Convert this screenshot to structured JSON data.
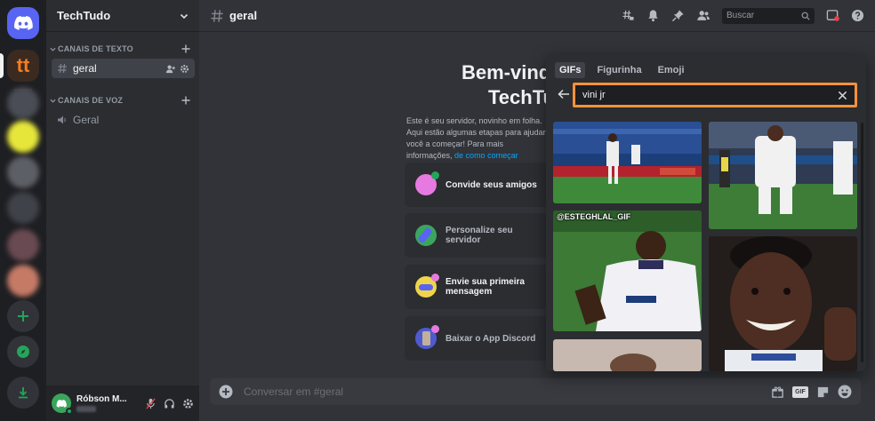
{
  "guild": {
    "name": "TechTudo"
  },
  "categories": {
    "text": "CANAIS DE TEXTO",
    "voice": "CANAIS DE VOZ"
  },
  "channels": {
    "text_active": "geral",
    "voice": "Geral"
  },
  "user": {
    "name": "Róbson M..."
  },
  "topbar": {
    "channel": "geral",
    "search_placeholder": "Buscar"
  },
  "welcome": {
    "title_line1": "Bem-vindo",
    "title_line2": "TechTudo",
    "subtitle": "Este é seu servidor, novinho em folha. Aqui estão algumas etapas para ajudar você a começar! Para mais informações,",
    "subtitle_link": "de como começar",
    "cards": [
      {
        "label": "Convide seus amigos"
      },
      {
        "label": "Personalize seu servidor"
      },
      {
        "label": "Envie sua primeira mensagem"
      },
      {
        "label": "Baixar o App Discord"
      }
    ]
  },
  "composer": {
    "placeholder": "Conversar em #geral",
    "gif_label": "GIF"
  },
  "picker": {
    "tabs": [
      "GIFs",
      "Figurinha",
      "Emoji"
    ],
    "selected_tab": "GIFs",
    "search_value": "vini jr",
    "gif_watermark": "@ESTEGHLAL_GIF"
  },
  "colors": {
    "accent": "#5865f2",
    "search_highlight": "#f5913c",
    "online": "#23a55a",
    "link": "#00a8fc"
  }
}
